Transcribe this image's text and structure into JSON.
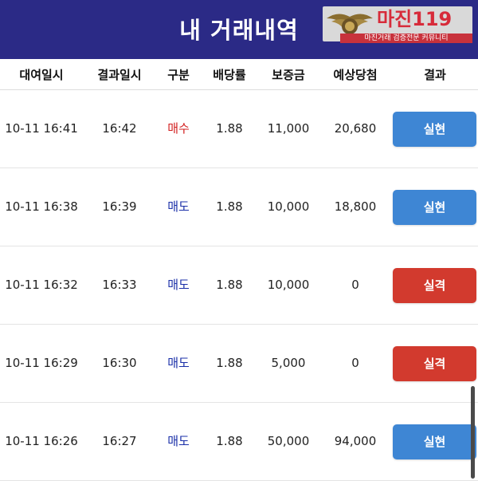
{
  "header": {
    "title": "내 거래내역",
    "logo_text": "마진119",
    "logo_subtitle": "마진거래 검증전문 커뮤니티"
  },
  "columns": [
    "대여일시",
    "결과일시",
    "구분",
    "배당률",
    "보증금",
    "예상당첨",
    "결과"
  ],
  "rows": [
    {
      "open_time": "10-11 16:41",
      "result_time": "16:42",
      "type": "매수",
      "odds": "1.88",
      "deposit": "11,000",
      "expected": "20,680",
      "result": "실현"
    },
    {
      "open_time": "10-11 16:38",
      "result_time": "16:39",
      "type": "매도",
      "odds": "1.88",
      "deposit": "10,000",
      "expected": "18,800",
      "result": "실현"
    },
    {
      "open_time": "10-11 16:32",
      "result_time": "16:33",
      "type": "매도",
      "odds": "1.88",
      "deposit": "10,000",
      "expected": "0",
      "result": "실격"
    },
    {
      "open_time": "10-11 16:29",
      "result_time": "16:30",
      "type": "매도",
      "odds": "1.88",
      "deposit": "5,000",
      "expected": "0",
      "result": "실격"
    },
    {
      "open_time": "10-11 16:26",
      "result_time": "16:27",
      "type": "매도",
      "odds": "1.88",
      "deposit": "50,000",
      "expected": "94,000",
      "result": "실현"
    }
  ],
  "colors": {
    "header_bg": "#2b2a86",
    "buy": "#d21f1f",
    "sell": "#1a2fa8",
    "win_button": "#3e86d4",
    "lose_button": "#d23a2e"
  }
}
